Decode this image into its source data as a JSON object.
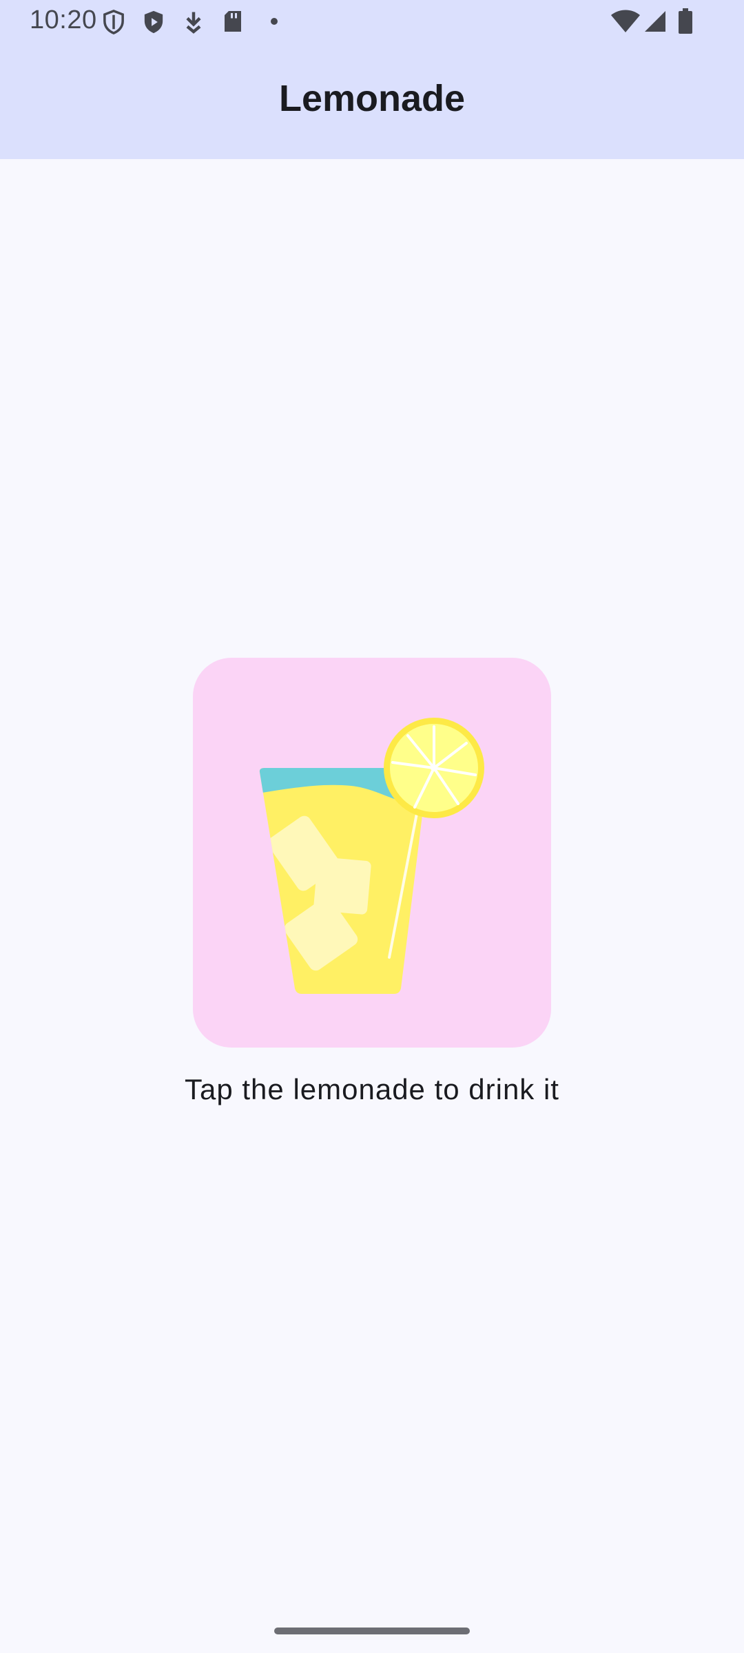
{
  "status_bar": {
    "time": "10:20",
    "icons": [
      "shield-outline-icon",
      "shield-play-icon",
      "download-icon",
      "sd-card-icon",
      "notification-dot-icon",
      "wifi-icon",
      "cellular-signal-icon",
      "battery-icon"
    ]
  },
  "app_bar": {
    "title": "Lemonade"
  },
  "main": {
    "image_description_icon": "lemonade-glass-icon",
    "instruction": "Tap the lemonade to drink it"
  },
  "colors": {
    "app_bar_bg": "#dbe0fd",
    "background": "#f8f8fe",
    "image_tile_bg": "#fbd4f6",
    "lemonade_yellow": "#fff064",
    "lemonade_top": "#6ccfd9"
  }
}
